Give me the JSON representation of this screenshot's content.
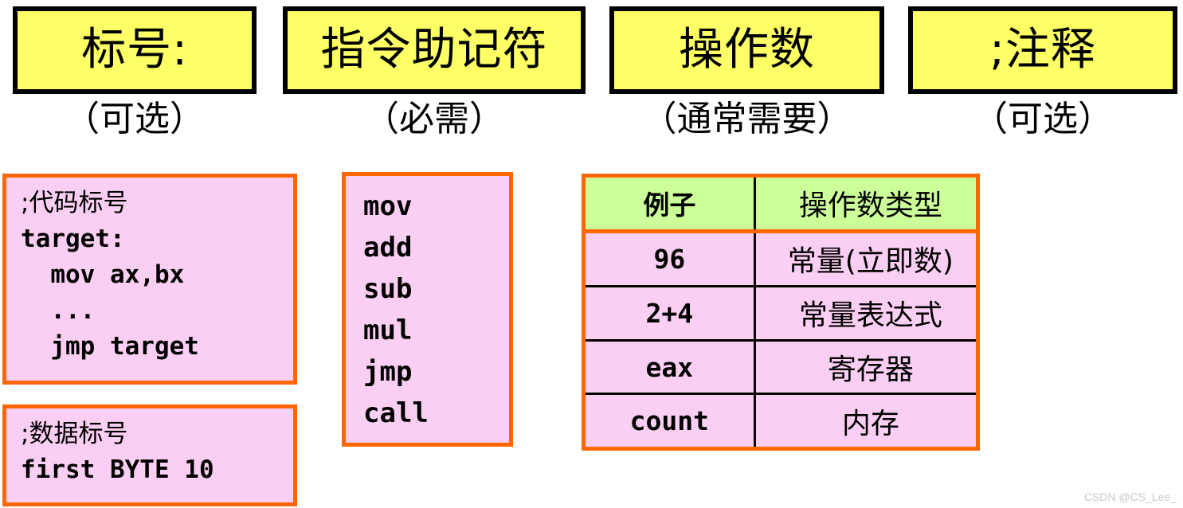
{
  "header": {
    "columns": [
      {
        "title": "标号:",
        "subtitle": "（可选）"
      },
      {
        "title": "指令助记符",
        "subtitle": "（必需）"
      },
      {
        "title": "操作数",
        "subtitle": "（通常需要）"
      },
      {
        "title": ";注释",
        "subtitle": "（可选）"
      }
    ]
  },
  "label_column": {
    "code_label_box": {
      "comment": ";代码标号",
      "lines": [
        "target:",
        "  mov ax,bx",
        "  ...",
        "  jmp target"
      ]
    },
    "data_label_box": {
      "comment": ";数据标号",
      "lines": [
        "first BYTE 10"
      ]
    }
  },
  "mnemonic_column": {
    "items": [
      "mov",
      "add",
      "sub",
      "mul",
      "jmp",
      "call"
    ]
  },
  "operand_column": {
    "table": {
      "headers": [
        "例子",
        "操作数类型"
      ],
      "rows": [
        {
          "example": "96",
          "type": "常量(立即数)"
        },
        {
          "example": "2+4",
          "type": "常量表达式"
        },
        {
          "example": "eax",
          "type": "寄存器"
        },
        {
          "example": "count",
          "type": "内存"
        }
      ]
    }
  },
  "watermark": {
    "text": "CSDN @CS_Lee_"
  },
  "colors": {
    "header_box_fill": "#FFFF66",
    "header_box_border": "#000000",
    "example_box_fill": "#FBCFF3",
    "example_box_border": "#FF6600",
    "table_header_fill": "#CCFF99",
    "table_border": "#FF6600",
    "table_gridline": "#000000",
    "watermark_text": "#C9C9C9"
  }
}
